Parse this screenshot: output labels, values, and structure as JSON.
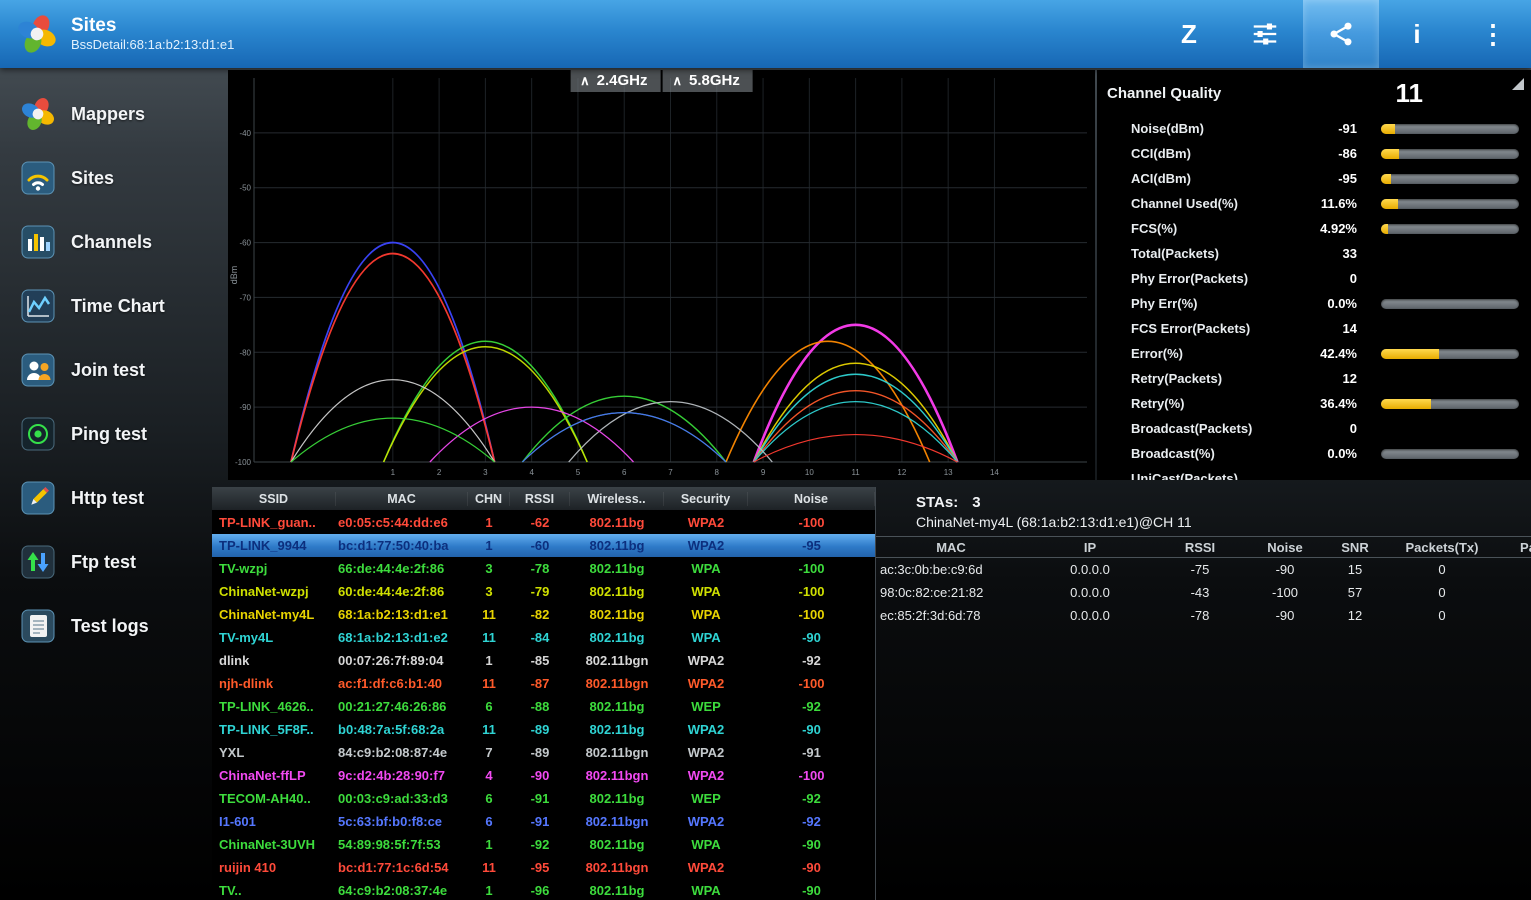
{
  "topbar": {
    "title": "Sites",
    "subtitle": "BssDetail:68:1a:b2:13:d1:e1",
    "actions": [
      {
        "name": "sort-z",
        "icon": "sort-z",
        "glyph": "Z",
        "highlighted": false
      },
      {
        "name": "tune",
        "icon": "tune",
        "glyph": "",
        "highlighted": false
      },
      {
        "name": "share",
        "icon": "share",
        "glyph": "",
        "highlighted": true
      },
      {
        "name": "info",
        "icon": "info",
        "glyph": "i",
        "highlighted": false
      },
      {
        "name": "overflow",
        "icon": "overflow",
        "glyph": "⋮",
        "highlighted": false
      }
    ]
  },
  "sidebar": {
    "items": [
      {
        "label": "Mappers",
        "icon": "pinwheel"
      },
      {
        "label": "Sites",
        "icon": "wifi"
      },
      {
        "label": "Channels",
        "icon": "channels"
      },
      {
        "label": "Time Chart",
        "icon": "timechart"
      },
      {
        "label": "Join test",
        "icon": "join"
      },
      {
        "label": "Ping test",
        "icon": "ping"
      },
      {
        "label": "Http test",
        "icon": "http"
      },
      {
        "label": "Ftp test",
        "icon": "ftp"
      },
      {
        "label": "Test logs",
        "icon": "logs"
      }
    ]
  },
  "spectrum": {
    "bands": [
      {
        "label": "2.4GHz",
        "caret": "∧"
      },
      {
        "label": "5.8GHz",
        "caret": "∧"
      }
    ],
    "ylabel": "dBm",
    "y_range": [
      -30,
      -100
    ],
    "x_range": [
      -2,
      16
    ],
    "y_ticks": [
      -40,
      -50,
      -60,
      -70,
      -80,
      -90,
      -100
    ],
    "x_ticks": [
      1,
      2,
      3,
      4,
      5,
      6,
      7,
      8,
      9,
      10,
      11,
      12,
      13,
      14
    ],
    "arcs": [
      {
        "channel": 1,
        "rssi": -60,
        "color": "#3c46ff",
        "width": 1.8
      },
      {
        "channel": 1,
        "rssi": -62,
        "color": "#ff3b30",
        "width": 1.8
      },
      {
        "channel": 3,
        "rssi": -78,
        "color": "#39d839",
        "width": 1.5
      },
      {
        "channel": 3,
        "rssi": -79,
        "color": "#c8e000",
        "width": 1.5
      },
      {
        "channel": 11,
        "rssi": -75,
        "color": "#ff3df2",
        "width": 2.6
      },
      {
        "channel": 10.4,
        "rssi": -78,
        "color": "#ff8a00",
        "width": 1.6
      },
      {
        "channel": 11,
        "rssi": -82,
        "color": "#e8d400",
        "width": 1.5
      },
      {
        "channel": 11,
        "rssi": -84,
        "color": "#2fd4d4",
        "width": 1.5
      },
      {
        "channel": 1,
        "rssi": -85,
        "color": "#d0d0d0",
        "width": 1.2
      },
      {
        "channel": 11,
        "rssi": -87,
        "color": "#ff5a2a",
        "width": 1.4
      },
      {
        "channel": 6,
        "rssi": -88,
        "color": "#39d839",
        "width": 1.4
      },
      {
        "channel": 11,
        "rssi": -89,
        "color": "#2fd4d4",
        "width": 1.3
      },
      {
        "channel": 7,
        "rssi": -89,
        "color": "#b8bec2",
        "width": 1.3
      },
      {
        "channel": 4,
        "rssi": -90,
        "color": "#f24af2",
        "width": 1.3
      },
      {
        "channel": 6,
        "rssi": -91,
        "color": "#39d839",
        "width": 1.2
      },
      {
        "channel": 6,
        "rssi": -91,
        "color": "#4a6aff",
        "width": 1.2
      },
      {
        "channel": 1,
        "rssi": -92,
        "color": "#39d839",
        "width": 1.2
      },
      {
        "channel": 11,
        "rssi": -95,
        "color": "#ff3b30",
        "width": 1.2
      }
    ]
  },
  "channel_quality": {
    "title": "Channel Quality",
    "channel": "11",
    "bar_color": "#f7c400",
    "rows": [
      {
        "label": "Noise(dBm)",
        "value": "-91",
        "bar": 10
      },
      {
        "label": "CCI(dBm)",
        "value": "-86",
        "bar": 13
      },
      {
        "label": "ACI(dBm)",
        "value": "-95",
        "bar": 7
      },
      {
        "label": "Channel Used(%)",
        "value": "11.6%",
        "bar": 12
      },
      {
        "label": "FCS(%)",
        "value": "4.92%",
        "bar": 5
      },
      {
        "label": "Total(Packets)",
        "value": "33",
        "bar": null
      },
      {
        "label": "Phy Error(Packets)",
        "value": "0",
        "bar": null
      },
      {
        "label": "Phy Err(%)",
        "value": "0.0%",
        "bar": 0
      },
      {
        "label": "FCS Error(Packets)",
        "value": "14",
        "bar": null
      },
      {
        "label": "Error(%)",
        "value": "42.4%",
        "bar": 42
      },
      {
        "label": "Retry(Packets)",
        "value": "12",
        "bar": null
      },
      {
        "label": "Retry(%)",
        "value": "36.4%",
        "bar": 36
      },
      {
        "label": "Broadcast(Packets)",
        "value": "0",
        "bar": null
      },
      {
        "label": "Broadcast(%)",
        "value": "0.0%",
        "bar": 0
      },
      {
        "label": "UniCast(Packets)",
        "value": "",
        "bar": null
      }
    ]
  },
  "networks": {
    "columns": [
      "SSID",
      "MAC",
      "CHN",
      "RSSI",
      "Wireless..",
      "Security",
      "Noise"
    ],
    "rows": [
      {
        "ssid": "TP-LINK_guan..",
        "mac": "e0:05:c5:44:dd:e6",
        "chn": "1",
        "rssi": "-62",
        "wireless": "802.11bg",
        "security": "WPA2",
        "noise": "-100",
        "color": "#ff4a3a",
        "selected": false
      },
      {
        "ssid": "TP-LINK_9944",
        "mac": "bc:d1:77:50:40:ba",
        "chn": "1",
        "rssi": "-60",
        "wireless": "802.11bg",
        "security": "WPA2",
        "noise": "-95",
        "color": "#0c2f7e",
        "selected": true
      },
      {
        "ssid": "TV-wzpj",
        "mac": "66:de:44:4e:2f:86",
        "chn": "3",
        "rssi": "-78",
        "wireless": "802.11bg",
        "security": "WPA",
        "noise": "-100",
        "color": "#3ddc3d",
        "selected": false
      },
      {
        "ssid": "ChinaNet-wzpj",
        "mac": "60:de:44:4e:2f:86",
        "chn": "3",
        "rssi": "-79",
        "wireless": "802.11bg",
        "security": "WPA",
        "noise": "-100",
        "color": "#cfe000",
        "selected": false
      },
      {
        "ssid": "ChinaNet-my4L",
        "mac": "68:1a:b2:13:d1:e1",
        "chn": "11",
        "rssi": "-82",
        "wireless": "802.11bg",
        "security": "WPA",
        "noise": "-100",
        "color": "#e8d400",
        "selected": false
      },
      {
        "ssid": "TV-my4L",
        "mac": "68:1a:b2:13:d1:e2",
        "chn": "11",
        "rssi": "-84",
        "wireless": "802.11bg",
        "security": "WPA",
        "noise": "-90",
        "color": "#2fd4d4",
        "selected": false
      },
      {
        "ssid": "dlink",
        "mac": "00:07:26:7f:89:04",
        "chn": "1",
        "rssi": "-85",
        "wireless": "802.11bgn",
        "security": "WPA2",
        "noise": "-92",
        "color": "#d6d6d6",
        "selected": false
      },
      {
        "ssid": "njh-dlink",
        "mac": "ac:f1:df:c6:b1:40",
        "chn": "11",
        "rssi": "-87",
        "wireless": "802.11bgn",
        "security": "WPA2",
        "noise": "-100",
        "color": "#ff5a2a",
        "selected": false
      },
      {
        "ssid": "TP-LINK_4626..",
        "mac": "00:21:27:46:26:86",
        "chn": "6",
        "rssi": "-88",
        "wireless": "802.11bg",
        "security": "WEP",
        "noise": "-92",
        "color": "#3ddc3d",
        "selected": false
      },
      {
        "ssid": "TP-LINK_5F8F..",
        "mac": "b0:48:7a:5f:68:2a",
        "chn": "11",
        "rssi": "-89",
        "wireless": "802.11bg",
        "security": "WPA2",
        "noise": "-90",
        "color": "#2fd4d4",
        "selected": false
      },
      {
        "ssid": "YXL",
        "mac": "84:c9:b2:08:87:4e",
        "chn": "7",
        "rssi": "-89",
        "wireless": "802.11bgn",
        "security": "WPA2",
        "noise": "-91",
        "color": "#c4c9cc",
        "selected": false
      },
      {
        "ssid": "ChinaNet-ffLP",
        "mac": "9c:d2:4b:28:90:f7",
        "chn": "4",
        "rssi": "-90",
        "wireless": "802.11bgn",
        "security": "WPA2",
        "noise": "-100",
        "color": "#f24af2",
        "selected": false
      },
      {
        "ssid": "TECOM-AH40..",
        "mac": "00:03:c9:ad:33:d3",
        "chn": "6",
        "rssi": "-91",
        "wireless": "802.11bg",
        "security": "WEP",
        "noise": "-92",
        "color": "#3ddc3d",
        "selected": false
      },
      {
        "ssid": "I1-601",
        "mac": "5c:63:bf:b0:f8:ce",
        "chn": "6",
        "rssi": "-91",
        "wireless": "802.11bgn",
        "security": "WPA2",
        "noise": "-92",
        "color": "#5577ff",
        "selected": false
      },
      {
        "ssid": "ChinaNet-3UVH",
        "mac": "54:89:98:5f:7f:53",
        "chn": "1",
        "rssi": "-92",
        "wireless": "802.11bg",
        "security": "WPA",
        "noise": "-90",
        "color": "#3ddc3d",
        "selected": false
      },
      {
        "ssid": "ruijin 410",
        "mac": "bc:d1:77:1c:6d:54",
        "chn": "11",
        "rssi": "-95",
        "wireless": "802.11bgn",
        "security": "WPA2",
        "noise": "-90",
        "color": "#ff4a3a",
        "selected": false
      },
      {
        "ssid": "TV..",
        "mac": "64:c9:b2:08:37:4e",
        "chn": "1",
        "rssi": "-96",
        "wireless": "802.11bg",
        "security": "WPA",
        "noise": "-90",
        "color": "#3ddc3d",
        "selected": false
      }
    ]
  },
  "stations": {
    "stas_label": "STAs:",
    "stas_count": "3",
    "bss_label": "ChinaNet-my4L (68:1a:b2:13:d1:e1)@CH 11",
    "columns": [
      "MAC",
      "IP",
      "RSSI",
      "Noise",
      "SNR",
      "Packets(Tx)",
      "Pa"
    ],
    "rows": [
      {
        "mac": "ac:3c:0b:be:c9:6d",
        "ip": "0.0.0.0",
        "rssi": "-75",
        "noise": "-90",
        "snr": "15",
        "tx": "0"
      },
      {
        "mac": "98:0c:82:ce:21:82",
        "ip": "0.0.0.0",
        "rssi": "-43",
        "noise": "-100",
        "snr": "57",
        "tx": "0"
      },
      {
        "mac": "ec:85:2f:3d:6d:78",
        "ip": "0.0.0.0",
        "rssi": "-78",
        "noise": "-90",
        "snr": "12",
        "tx": "0"
      }
    ]
  }
}
